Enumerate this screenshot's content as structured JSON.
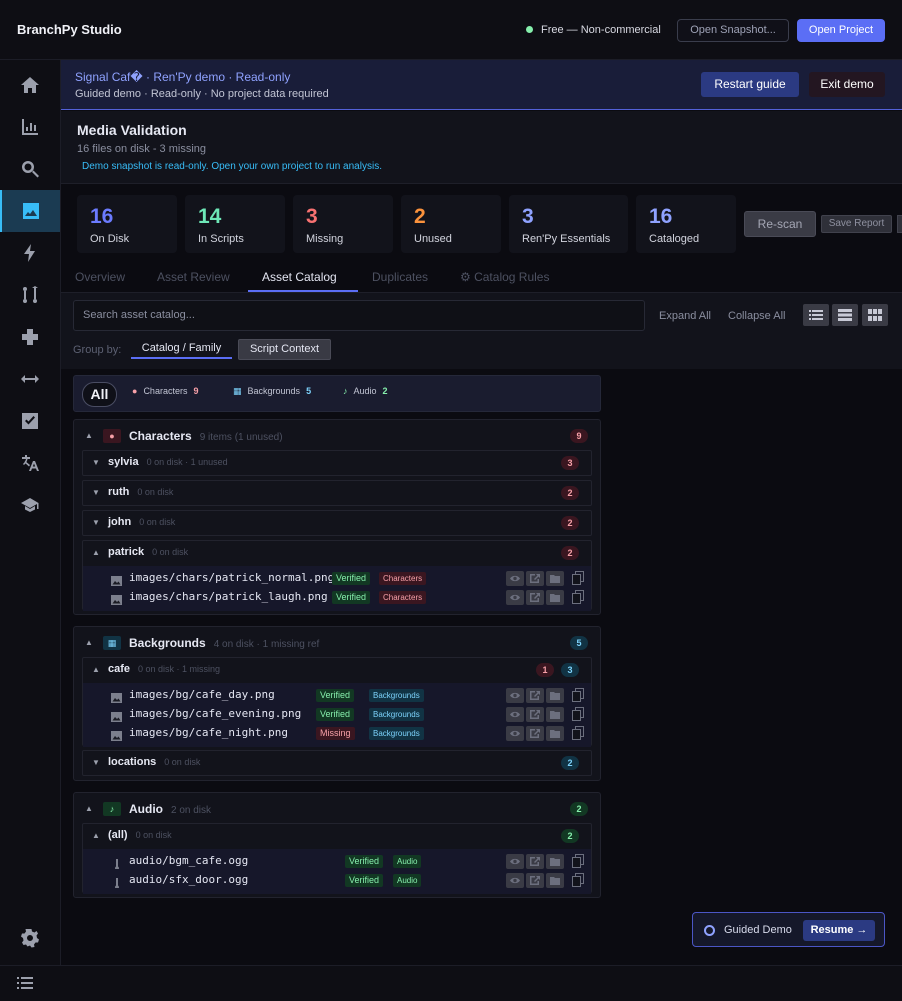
{
  "app": {
    "title": "BranchPy Studio",
    "license": "Free — Non-commercial",
    "open_snapshot": "Open Snapshot...",
    "open_project": "Open Project"
  },
  "sidebar": {
    "items": [
      "home-icon",
      "chart-icon",
      "search-icon",
      "image-icon",
      "bolt-icon",
      "branch-icon",
      "plus-icon",
      "arrows-icon",
      "checkbox-icon",
      "translate-icon",
      "graduation-icon"
    ],
    "settings": "gear-icon",
    "active": "image-icon"
  },
  "banner": {
    "title": "Signal Caf� · Ren'Py demo · Read-only",
    "subtitle": "Guided demo · Read-only · No project data required",
    "restart": "Restart guide",
    "exit": "Exit demo"
  },
  "header": {
    "title": "Media Validation",
    "subtitle": "16 files on disk - 3 missing",
    "note": "Demo snapshot is read-only. Open your own project to run analysis."
  },
  "stats": [
    {
      "value": "16",
      "label": "On Disk",
      "color": "#6b7bff"
    },
    {
      "value": "14",
      "label": "In Scripts",
      "color": "#6ee7b7"
    },
    {
      "value": "3",
      "label": "Missing",
      "color": "#f87171"
    },
    {
      "value": "2",
      "label": "Unused",
      "color": "#fb923c"
    },
    {
      "value": "3",
      "label": "Ren'Py Essentials",
      "color": "#8fa2ff"
    },
    {
      "value": "16",
      "label": "Cataloged",
      "color": "#8fa2ff"
    }
  ],
  "actions": {
    "rescan": "Re-scan",
    "save_report": "Save Report"
  },
  "tabs": [
    "Overview",
    "Asset Review",
    "Asset Catalog",
    "Duplicates",
    "⚙ Catalog Rules"
  ],
  "active_tab": "Asset Catalog",
  "toolbar": {
    "search_placeholder": "Search asset catalog...",
    "expand_all": "Expand All",
    "collapse_all": "Collapse All",
    "group_by": "Group by:",
    "group_catalog": "Catalog / Family",
    "group_script": "Script Context"
  },
  "filters": {
    "all": "All",
    "items": [
      {
        "label": "Characters",
        "count": "9",
        "color": "#f7a0a8"
      },
      {
        "label": "Backgrounds",
        "count": "5",
        "color": "#7dd3fc"
      },
      {
        "label": "Audio",
        "count": "2",
        "color": "#86efac"
      }
    ]
  },
  "groups": [
    {
      "name": "Characters",
      "meta": "9 items (1 unused)",
      "badge": "9",
      "subs": [
        {
          "name": "sylvia",
          "meta": "0 on disk · 1 unused",
          "badges": [
            "3"
          ]
        },
        {
          "name": "ruth",
          "meta": "0 on disk",
          "badges": [
            "2"
          ]
        },
        {
          "name": "john",
          "meta": "0 on disk",
          "badges": [
            "2"
          ]
        },
        {
          "name": "patrick",
          "meta": "0 on disk",
          "badges": [
            "2"
          ],
          "files": [
            {
              "path": "images/chars/patrick_normal.png",
              "status": "Verified",
              "tag": "Characters"
            },
            {
              "path": "images/chars/patrick_laugh.png",
              "status": "Verified",
              "tag": "Characters"
            }
          ]
        }
      ]
    },
    {
      "name": "Backgrounds",
      "meta": "4 on disk · 1 missing ref",
      "badge": "5",
      "subs": [
        {
          "name": "cafe",
          "meta": "0 on disk · 1 missing",
          "badges": [
            "1",
            "3"
          ],
          "files": [
            {
              "path": "images/bg/cafe_day.png",
              "status": "Verified",
              "tag": "Backgrounds"
            },
            {
              "path": "images/bg/cafe_evening.png",
              "status": "Verified",
              "tag": "Backgrounds"
            },
            {
              "path": "images/bg/cafe_night.png",
              "status": "Missing",
              "tag": "Backgrounds"
            }
          ]
        },
        {
          "name": "locations",
          "meta": "0 on disk",
          "badges": [
            "2"
          ]
        }
      ]
    },
    {
      "name": "Audio",
      "meta": "2 on disk",
      "badge": "2",
      "subs": [
        {
          "name": "(all)",
          "meta": "0 on disk",
          "badges": [
            "2"
          ],
          "files": [
            {
              "path": "audio/bgm_cafe.ogg",
              "status": "Verified",
              "tag": "Audio"
            },
            {
              "path": "audio/sfx_door.ogg",
              "status": "Verified",
              "tag": "Audio"
            }
          ]
        }
      ]
    }
  ],
  "demo": {
    "label": "Guided Demo",
    "resume": "Resume →"
  }
}
